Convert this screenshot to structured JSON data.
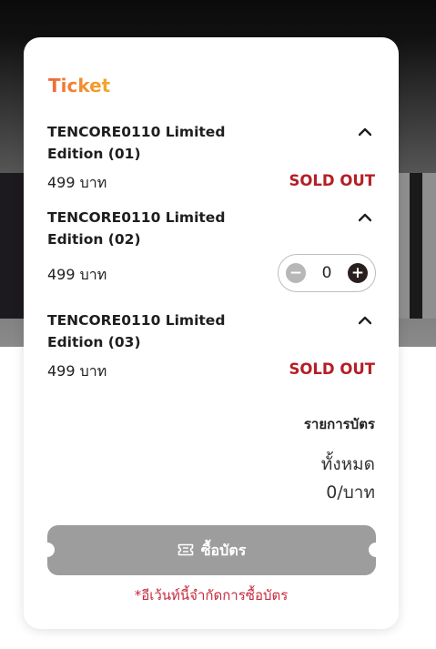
{
  "ticket": {
    "title": "Ticket",
    "items": [
      {
        "name": "TENCORE0110 Limited Edition (01)",
        "price": "499  บาท",
        "status": "SOLD OUT"
      },
      {
        "name": "TENCORE0110 Limited Edition (02)",
        "price": "499  บาท",
        "quantity": "0",
        "minus_label": "−",
        "plus_label": "+"
      },
      {
        "name": "TENCORE0110 Limited Edition (03)",
        "price": "499  บาท",
        "status": "SOLD OUT"
      }
    ]
  },
  "summary": {
    "label": "รายการบัตร",
    "all": "ทั้งหมด",
    "total": "0/บาท"
  },
  "buy_button": {
    "label": "ซื้อบัตร"
  },
  "notice": "*อีเว้นท์นี้จำกัดการซื้อบัตร",
  "colors": {
    "sold_out": "#b51e25",
    "title_gradient_start": "#f0683a",
    "title_gradient_end": "#f4ab2a",
    "button_disabled": "#9d9d9d",
    "notice": "#c8283c"
  },
  "icons": {
    "chevron": "chevron-up-icon",
    "ticket": "ticket-icon"
  }
}
